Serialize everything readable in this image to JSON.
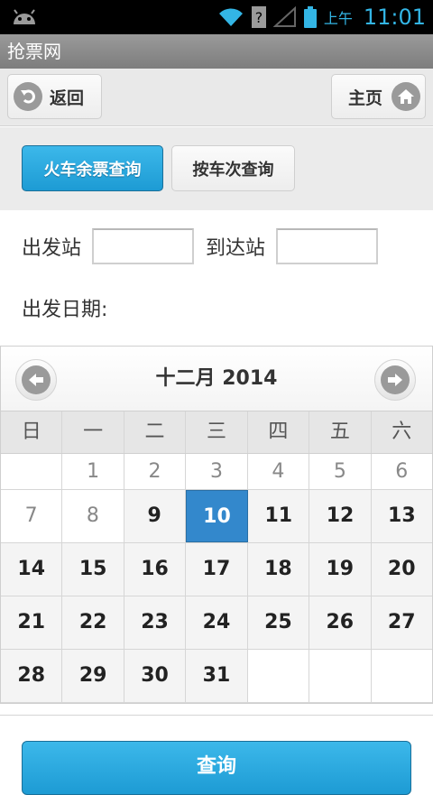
{
  "status_bar": {
    "ampm": "上午",
    "time": "11:01"
  },
  "app": {
    "title": "抢票网"
  },
  "header": {
    "back_label": "返回",
    "home_label": "主页"
  },
  "tabs": [
    {
      "label": "火车余票查询",
      "active": true
    },
    {
      "label": "按车次查询",
      "active": false
    }
  ],
  "form": {
    "from_label": "出发站",
    "from_value": "",
    "to_label": "到达站",
    "to_value": "",
    "date_label": "出发日期:"
  },
  "calendar": {
    "title": "十二月 2014",
    "weekdays": [
      "日",
      "一",
      "二",
      "三",
      "四",
      "五",
      "六"
    ],
    "rows": [
      [
        "",
        "1",
        "2",
        "3",
        "4",
        "5",
        "6"
      ],
      [
        "7",
        "8",
        "9",
        "10",
        "11",
        "12",
        "13"
      ],
      [
        "14",
        "15",
        "16",
        "17",
        "18",
        "19",
        "20"
      ],
      [
        "21",
        "22",
        "23",
        "24",
        "25",
        "26",
        "27"
      ],
      [
        "28",
        "29",
        "30",
        "31",
        "",
        "",
        ""
      ]
    ],
    "selected": "10"
  },
  "submit": {
    "label": "查询"
  },
  "colors": {
    "accent": "#1d9bd4",
    "selected_day": "#3388cc",
    "status_icons": "#33b5e5"
  }
}
